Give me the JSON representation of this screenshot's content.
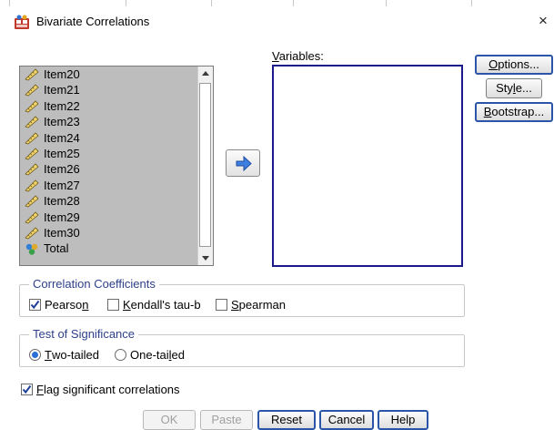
{
  "window": {
    "title": "Bivariate Correlations",
    "close_glyph": "×",
    "icon": "spss-dialog-icon"
  },
  "source_list": {
    "items": [
      {
        "label": "Item20",
        "icon": "ruler-scale-icon"
      },
      {
        "label": "Item21",
        "icon": "ruler-scale-icon"
      },
      {
        "label": "Item22",
        "icon": "ruler-scale-icon"
      },
      {
        "label": "Item23",
        "icon": "ruler-scale-icon"
      },
      {
        "label": "Item24",
        "icon": "ruler-scale-icon"
      },
      {
        "label": "Item25",
        "icon": "ruler-scale-icon"
      },
      {
        "label": "Item26",
        "icon": "ruler-scale-icon"
      },
      {
        "label": "Item27",
        "icon": "ruler-scale-icon"
      },
      {
        "label": "Item28",
        "icon": "ruler-scale-icon"
      },
      {
        "label": "Item29",
        "icon": "ruler-scale-icon"
      },
      {
        "label": "Item30",
        "icon": "ruler-scale-icon"
      },
      {
        "label": "Total",
        "icon": "nominal-spheres-icon"
      }
    ]
  },
  "move_button": {
    "icon": "arrow-right-icon"
  },
  "variables": {
    "label_first": "V",
    "label_rest": "ariables:"
  },
  "side_buttons": {
    "options": {
      "ul": "O",
      "rest": "ptions..."
    },
    "style": {
      "pre": "Sty",
      "ul": "l",
      "rest": "e..."
    },
    "bootstrap": {
      "ul": "B",
      "rest": "ootstrap..."
    }
  },
  "correlation": {
    "title": "Correlation Coefficients",
    "pearson": {
      "pre": "Pearso",
      "ul": "n",
      "rest": "",
      "checked": true
    },
    "kendall": {
      "pre": "",
      "ul": "K",
      "rest": "endall's tau-b",
      "checked": false
    },
    "spearman": {
      "pre": "",
      "ul": "S",
      "rest": "pearman",
      "checked": false
    }
  },
  "significance": {
    "title": "Test of Significance",
    "two": {
      "pre": "",
      "ul": "T",
      "rest": "wo-tailed",
      "checked": true
    },
    "one": {
      "pre": "One-tai",
      "ul": "l",
      "rest": "ed",
      "checked": false
    }
  },
  "flag": {
    "pre": "",
    "ul": "F",
    "rest": "lag significant correlations",
    "checked": true
  },
  "bottom_buttons": {
    "ok": "OK",
    "paste": "Paste",
    "reset": "Reset",
    "cancel": "Cancel",
    "help": "Help"
  },
  "colors": {
    "list_background": "#bdbdbd",
    "target_border": "#1a1a8c",
    "group_title": "#2d3f8a",
    "default_button_border": "#2b55a8"
  }
}
